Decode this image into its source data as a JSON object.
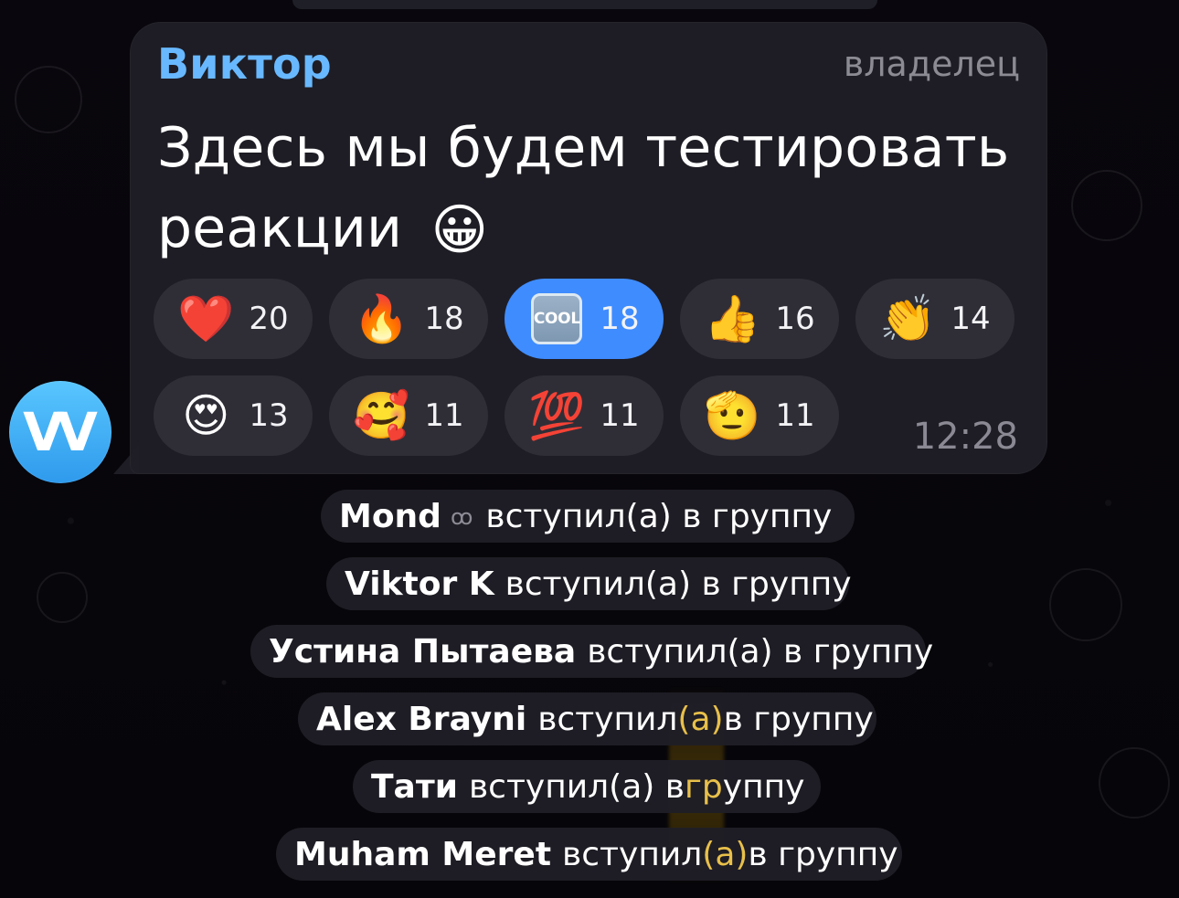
{
  "theme": {
    "background": "#07060b",
    "bubble": "#1f1e26",
    "accent": "#3f8cff",
    "author_color": "#68b8ff",
    "muted": "#8b8a94",
    "highlight": "#e8c04a"
  },
  "chat": {
    "avatar_text": "VV",
    "author": "Виктор",
    "role": "владелец",
    "message_text": "Здесь мы будем тестировать реакции",
    "message_emoji": "😀",
    "time": "12:28",
    "reactions_row1": [
      {
        "emoji": "❤️",
        "icon_name": "heart-icon",
        "count": "20",
        "selected": false
      },
      {
        "emoji": "🔥",
        "icon_name": "fire-icon",
        "count": "18",
        "selected": false
      },
      {
        "emoji": "COOL",
        "icon_name": "cool-icon",
        "count": "18",
        "selected": true
      },
      {
        "emoji": "👍",
        "icon_name": "thumbs-up-icon",
        "count": "16",
        "selected": false
      },
      {
        "emoji": "👏",
        "icon_name": "clapping-icon",
        "count": "14",
        "selected": false
      }
    ],
    "reactions_row2": [
      {
        "emoji": "😍",
        "icon_name": "heart-eyes-icon",
        "count": "13",
        "selected": false
      },
      {
        "emoji": "🥰",
        "icon_name": "smiling-hearts-icon",
        "count": "11",
        "selected": false
      },
      {
        "emoji": "💯",
        "icon_name": "hundred-icon",
        "count": "11",
        "selected": false
      },
      {
        "emoji": "🫡",
        "icon_name": "salute-icon",
        "count": "11",
        "selected": false
      }
    ]
  },
  "system_messages": [
    {
      "name": "Mond",
      "icon": "ꝏ",
      "text": "вступил(а) в группу"
    },
    {
      "name": "Viktor K",
      "text": "вступил(а) в группу"
    },
    {
      "name": "Устина Пытаева",
      "text": "вступил(а) в группу"
    },
    {
      "name": "Alex Brayni",
      "text_before": "вступил",
      "text_highlight": "(а)",
      "text_after": " в группу"
    },
    {
      "name": "Тати",
      "text_before": "вступил(а) в ",
      "text_highlight": "гр",
      "text_after": "уппу"
    },
    {
      "name": "Muham Meret",
      "text_before": "вступил",
      "text_highlight": "(а)",
      "text_after": " в группу"
    }
  ]
}
